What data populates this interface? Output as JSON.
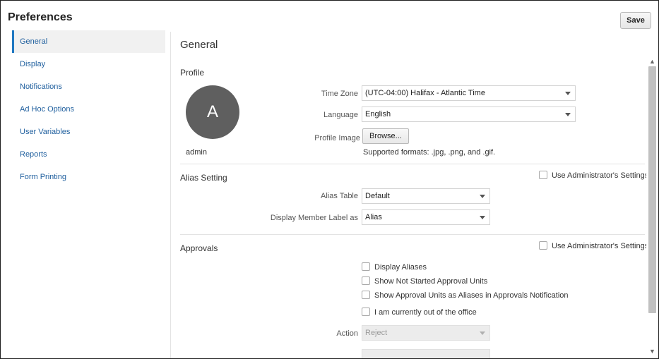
{
  "header": {
    "title": "Preferences",
    "save_label": "Save"
  },
  "sidebar": {
    "items": [
      {
        "label": "General",
        "active": true
      },
      {
        "label": "Display"
      },
      {
        "label": "Notifications"
      },
      {
        "label": "Ad Hoc Options"
      },
      {
        "label": "User Variables"
      },
      {
        "label": "Reports"
      },
      {
        "label": "Form Printing"
      }
    ]
  },
  "main": {
    "title": "General",
    "profile": {
      "section_title": "Profile",
      "avatar_letter": "A",
      "username": "admin",
      "time_zone_label": "Time Zone",
      "time_zone_value": "(UTC-04:00) Halifax - Atlantic Time",
      "language_label": "Language",
      "language_value": "English",
      "profile_image_label": "Profile Image",
      "browse_label": "Browse...",
      "formats_hint": "Supported formats: .jpg, .png, and .gif."
    },
    "alias": {
      "section_title": "Alias Setting",
      "admin_settings_label": "Use Administrator's Settings",
      "alias_table_label": "Alias Table",
      "alias_table_value": "Default",
      "display_member_label": "Display Member Label as",
      "display_member_value": "Alias"
    },
    "approvals": {
      "section_title": "Approvals",
      "admin_settings_label": "Use Administrator's Settings",
      "display_aliases_label": "Display Aliases",
      "show_not_started_label": "Show Not Started Approval Units",
      "show_units_aliases_label": "Show Approval Units as Aliases in Approvals Notification",
      "out_of_office_label": "I am currently out of the office",
      "action_label": "Action",
      "action_value": "Reject"
    }
  },
  "icons": {
    "caret": "chevron-down-icon",
    "scroll_up": "scroll-up-arrow-icon",
    "scroll_down": "scroll-down-arrow-icon"
  }
}
